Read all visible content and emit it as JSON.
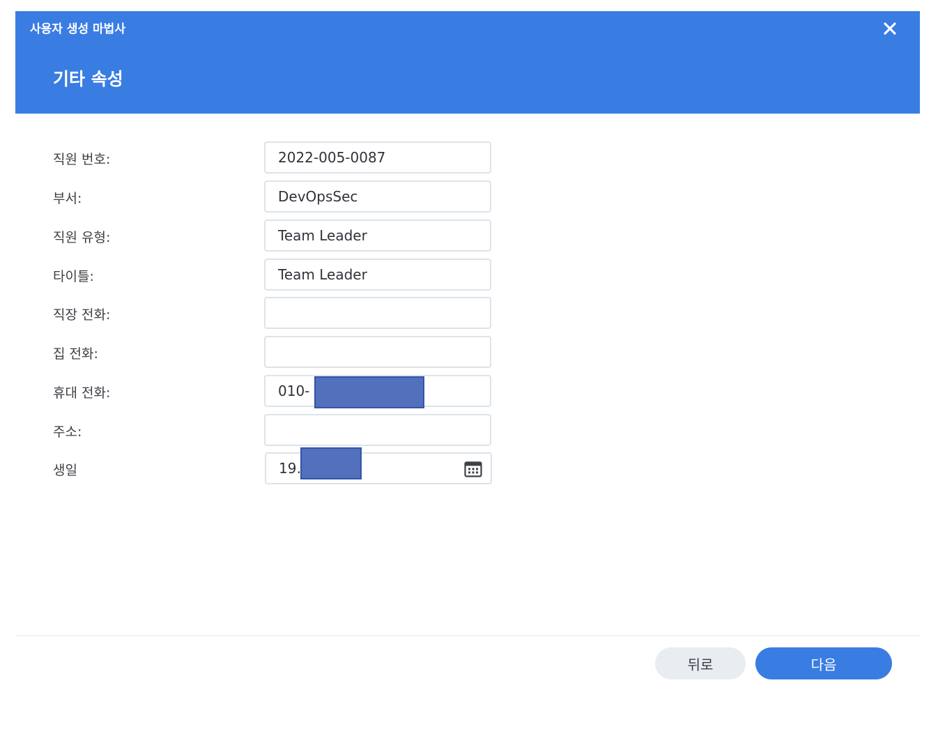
{
  "dialog": {
    "wizard_title": "사용자 생성 마법사",
    "step_title": "기타 속성"
  },
  "form": {
    "employee_number": {
      "label": "직원 번호:",
      "value": "2022-005-0087"
    },
    "department": {
      "label": "부서:",
      "value": "DevOpsSec"
    },
    "employee_type": {
      "label": "직원 유형:",
      "value": "Team Leader"
    },
    "title": {
      "label": "타이틀:",
      "value": "Team Leader"
    },
    "work_phone": {
      "label": "직장 전화:",
      "value": ""
    },
    "home_phone": {
      "label": "집 전화:",
      "value": ""
    },
    "mobile_phone": {
      "label": "휴대 전화:",
      "value": "010-"
    },
    "address": {
      "label": "주소:",
      "value": ""
    },
    "birthday": {
      "label": "생일",
      "value": "19…5"
    }
  },
  "footer": {
    "back_label": "뒤로",
    "next_label": "다음"
  },
  "colors": {
    "accent": "#397de3",
    "redaction": "#5270bb"
  },
  "icons": {
    "close": "close-icon",
    "calendar": "calendar-icon"
  }
}
